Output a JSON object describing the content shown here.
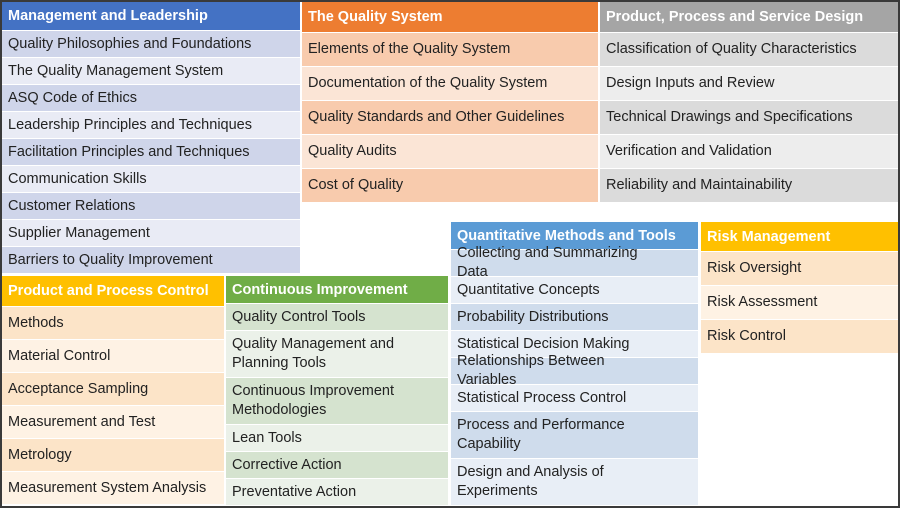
{
  "colors": {
    "management": {
      "header": "#4472c4",
      "dark": "#cfd5ea",
      "light": "#e9ebf5"
    },
    "quality_system": {
      "header": "#ed7d31",
      "dark": "#f8cbad",
      "light": "#fbe5d6"
    },
    "design": {
      "header": "#a5a5a5",
      "dark": "#dbdbdb",
      "light": "#ededed"
    },
    "product_control": {
      "header": "#ffc000",
      "dark": "#fce4c8",
      "light": "#fef2e4"
    },
    "continuous": {
      "header": "#70ad47",
      "dark": "#d5e3cf",
      "light": "#ebf1e9"
    },
    "quantitative": {
      "header": "#5b9bd5",
      "dark": "#cfdcec",
      "light": "#e8eef6"
    },
    "risk": {
      "header": "#ffc000",
      "dark": "#fce4c8",
      "light": "#fef2e4"
    }
  },
  "blocks": {
    "management": {
      "title": "Management and Leadership",
      "items": [
        "Quality Philosophies and Foundations",
        "The Quality Management System",
        "ASQ Code of Ethics",
        "Leadership Principles and Techniques",
        "Facilitation Principles and Techniques",
        "Communication Skills",
        "Customer Relations",
        "Supplier Management",
        "Barriers to Quality Improvement"
      ]
    },
    "quality_system": {
      "title": "The Quality System",
      "items": [
        "Elements of the Quality System",
        "Documentation of the Quality System",
        "Quality Standards and Other Guidelines",
        "Quality Audits",
        "Cost of Quality"
      ]
    },
    "design": {
      "title": "Product, Process and Service Design",
      "items": [
        "Classification of Quality Characteristics",
        "Design Inputs and Review",
        "Technical Drawings and Specifications",
        "Verification and Validation",
        "Reliability and Maintainability"
      ]
    },
    "product_control": {
      "title": "Product and Process Control",
      "items": [
        "Methods",
        "Material Control",
        "Acceptance Sampling",
        "Measurement and Test",
        "Metrology",
        "Measurement System Analysis"
      ]
    },
    "continuous": {
      "title": "Continuous Improvement",
      "items": [
        "Quality Control Tools",
        "Quality Management and Planning Tools",
        "Continuous Improvement Methodologies",
        "Lean Tools",
        "Corrective Action",
        "Preventative Action"
      ]
    },
    "quantitative": {
      "title": "Quantitative Methods and Tools",
      "items": [
        "Collecting and Summarizing Data",
        "Quantitative Concepts",
        "Probability Distributions",
        "Statistical Decision Making",
        "Relationships Between Variables",
        "Statistical Process Control",
        "Process and Performance Capability",
        "Design and Analysis of Experiments"
      ]
    },
    "risk": {
      "title": "Risk Management",
      "items": [
        "Risk Oversight",
        "Risk Assessment",
        "Risk Control"
      ]
    }
  }
}
